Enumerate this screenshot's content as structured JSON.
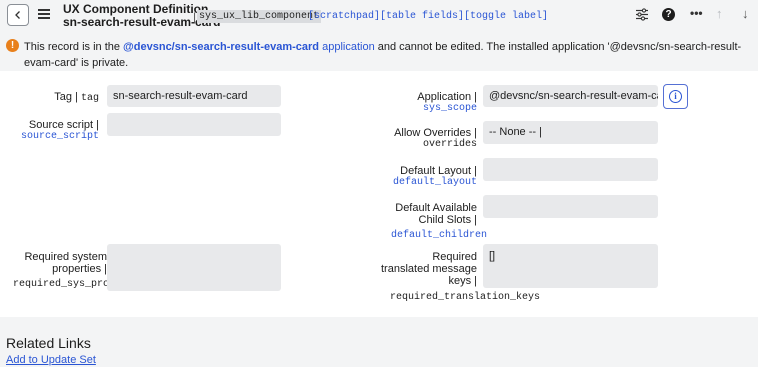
{
  "header": {
    "title_line1": "UX Component Definition",
    "title_line2": "sn-search-result-evam-card",
    "separator": "|",
    "table_name": "sys_ux_lib_component",
    "table_links": "[scratchpad][table fields][toggle label]"
  },
  "banner": {
    "text_before": "This record is in the ",
    "app_link": "@devsnc/sn-search-result-evam-card",
    "link_word": "application",
    "text_after": " and cannot be edited. The installed application '@devsnc/sn-search-result-evam-card' is private."
  },
  "form": {
    "tag": {
      "label": "Tag | ",
      "field_name": "tag",
      "value": "sn-search-result-evam-card"
    },
    "source_script": {
      "label": "Source script |",
      "field_name": "source_script",
      "value": ""
    },
    "required_sys_props": {
      "label_line1": "Required system",
      "label_line2": "properties |",
      "field_name": "required_sys_pro",
      "value": ""
    },
    "application": {
      "label": "Application |",
      "field_name": "sys_scope",
      "value": "@devsnc/sn-search-result-evam-card"
    },
    "allow_overrides": {
      "label": "Allow Overrides |",
      "field_name": "overrides",
      "value": "-- None -- |"
    },
    "default_layout": {
      "label": "Default Layout |",
      "field_name": "default_layout",
      "value": ""
    },
    "default_children": {
      "label_line1": "Default Available",
      "label_line2": "Child Slots |",
      "field_name": "default_children",
      "value": ""
    },
    "required_translation": {
      "label_line1": "Required",
      "label_line2": "translated message",
      "label_line3": "keys |",
      "field_name": "required_translation_keys",
      "value": "[]"
    }
  },
  "related": {
    "title": "Related Links",
    "link": "Add to Update Set"
  }
}
